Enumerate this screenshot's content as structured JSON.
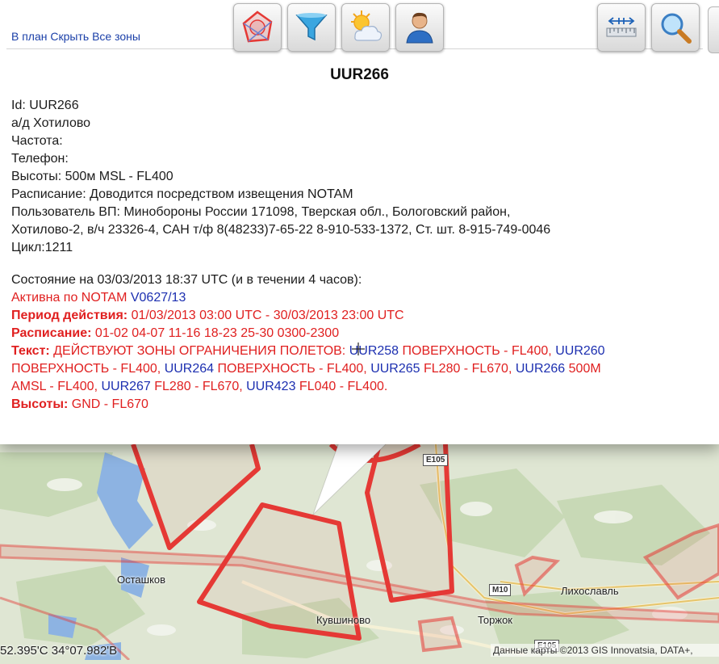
{
  "popup": {
    "links": [
      "В план",
      "Скрыть",
      "Все зоны"
    ],
    "title": "UUR266",
    "info_lines": [
      "Id: UUR266",
      "а/д Хотилово",
      "Частота:",
      "Телефон:",
      "Высоты: 500м MSL - FL400",
      "Расписание: Доводится посредством извещения NOTAM",
      "Пользователь ВП: Минобороны России 171098, Тверская обл., Бологовский район,",
      "Хотилово-2, в/ч 23326-4, САН т/ф 8(48233)7-65-22 8-910-533-1372, Ст. шт. 8-915-749-0046",
      "Цикл:1211"
    ],
    "status": {
      "heading": "Состояние на 03/03/2013 18:37 UTC (и в течении 4 часов):",
      "active_prefix": "Активна по NOTAM ",
      "notam_id": "V0627/13",
      "period_label": "Период действия:",
      "period_value": " 01/03/2013 03:00 UTC - 30/03/2013 23:00 UTC",
      "schedule_label": "Расписание:",
      "schedule_value": " 01-02 04-07 11-16 18-23 25-30 0300-2300",
      "text_label": "Текст:",
      "text_1": " ДЕЙСТВУЮТ ЗОНЫ ОГРАНИЧЕНИЯ ПОЛЕТОВ: ",
      "zone_a": "UUR258",
      "text_2": " ПОВЕРХНОСТЬ - FL400, ",
      "zone_b": "UUR260",
      "text_3": "ПОВЕРХНОСТЬ - FL400, ",
      "zone_c": "UUR264",
      "text_4": " ПОВЕРХНОСТЬ - FL400, ",
      "zone_d": "UUR265",
      "text_5": " FL280 - FL670, ",
      "zone_e": "UUR266",
      "text_6": " 500M",
      "text_7": "AMSL - FL400, ",
      "zone_f": "UUR267",
      "text_8": " FL280 - FL670, ",
      "zone_g": "UUR423",
      "text_9": " FL040 - FL400.",
      "heights_label": "Высоты:",
      "heights_value": " GND - FL670"
    }
  },
  "toolbar": {
    "buttons": [
      {
        "name": "airspace-zones-icon"
      },
      {
        "name": "filter-icon"
      },
      {
        "name": "weather-icon"
      },
      {
        "name": "user-icon"
      },
      {
        "name": "ruler-icon"
      },
      {
        "name": "search-icon"
      }
    ]
  },
  "map": {
    "places": [
      "Осташков",
      "Кувшиново",
      "Торжок",
      "Лихославль"
    ],
    "roads": [
      "E105",
      "M10",
      "E105"
    ],
    "coordinates": "52.395'С 34°07.982'В",
    "copyright": "Данные карты ©2013 GIS Innovatsia, DATA+,"
  },
  "colors": {
    "zone_red": "#e53935",
    "link_blue": "#1a3fa8",
    "notam_red": "#e02020",
    "zone_blue": "#1c2fb0"
  }
}
